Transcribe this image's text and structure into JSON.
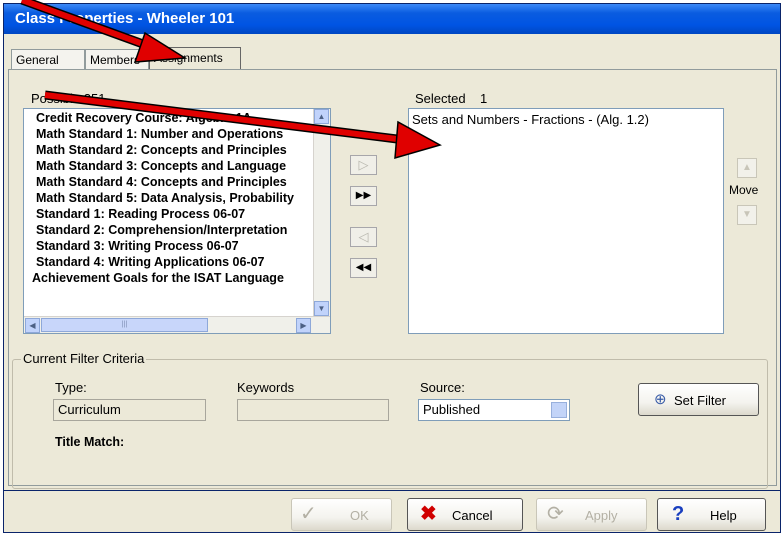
{
  "window": {
    "title": "Class Properties - Wheeler 101"
  },
  "tabs": [
    {
      "label": "General"
    },
    {
      "label": "Members"
    },
    {
      "label": "Assignments"
    }
  ],
  "available": {
    "label": "Possible",
    "count": "351",
    "items": [
      "Credit Recovery Course: Algebra 1A",
      "Math Standard 1: Number and Operations",
      "Math Standard 2: Concepts and Principles",
      "Math Standard 3: Concepts and Language",
      "Math Standard 4: Concepts and Principles",
      "Math Standard 5: Data Analysis, Probability",
      "Standard 1: Reading Process 06-07",
      "Standard 2: Comprehension/Interpretation",
      "Standard 3: Writing Process 06-07",
      "Standard 4: Writing Applications 06-07",
      "Achievement Goals for the ISAT Language"
    ]
  },
  "selected": {
    "label": "Selected",
    "count": "1",
    "items": [
      "Sets and Numbers - Fractions - (Alg. 1.2)"
    ]
  },
  "transfer_buttons": {
    "add": "▷",
    "add_all": "▶▶",
    "remove": "◁",
    "remove_all": "◀◀"
  },
  "move": {
    "label": "Move",
    "up": "▲",
    "down": "▼"
  },
  "filter": {
    "legend": "Current Filter Criteria",
    "type_label": "Type:",
    "type_value": "Curriculum",
    "keywords_label": "Keywords",
    "keywords_value": "",
    "source_label": "Source:",
    "source_value": "Published",
    "title_match_label": "Title Match:",
    "set_filter_label": "Set Filter"
  },
  "footer": {
    "ok_label": "OK",
    "cancel_label": "Cancel",
    "apply_label": "Apply",
    "help_label": "Help"
  },
  "colors": {
    "title_bar": "#0054e3",
    "annotation_arrow": "#e00000"
  }
}
